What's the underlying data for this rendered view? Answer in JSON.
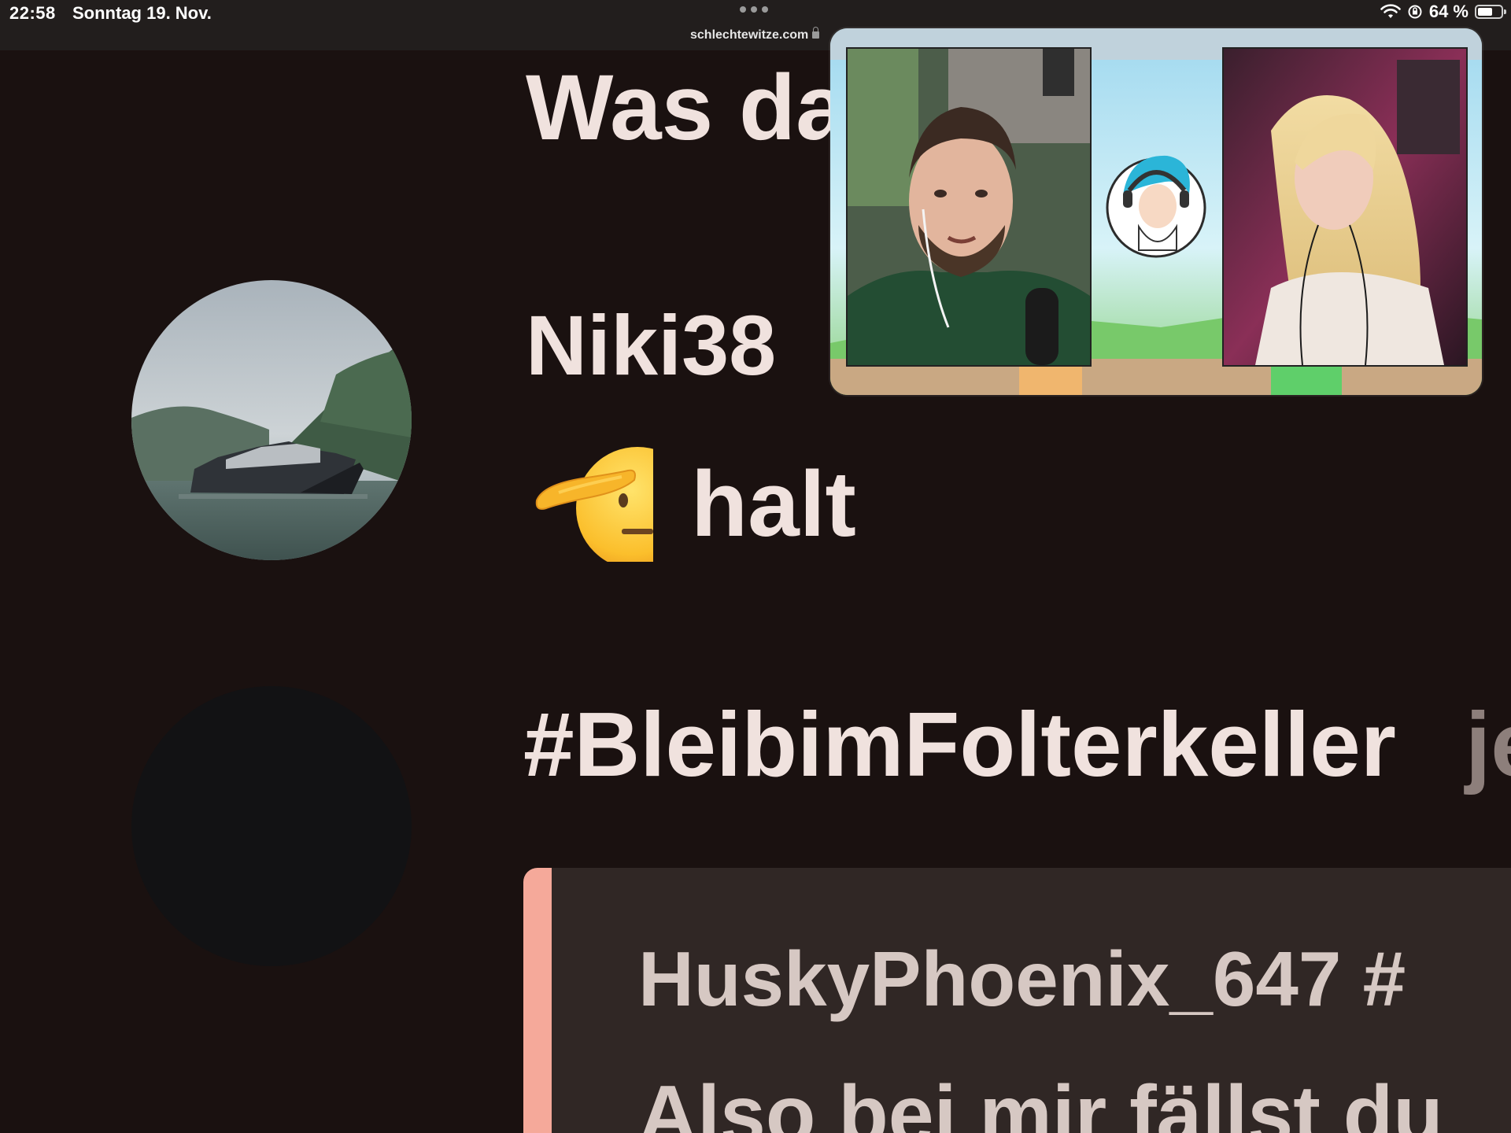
{
  "status_bar": {
    "time": "22:58",
    "date": "Sonntag 19. Nov.",
    "url": "schlechtewitze.com",
    "battery_label": "64 %",
    "battery_level": 0.64,
    "icons": [
      "wifi-icon",
      "orientation-lock-icon",
      "battery-icon",
      "lock-icon"
    ]
  },
  "feed": {
    "line_1": "Was da",
    "line_2": "Niki38",
    "line_3_emoji": "saluting-face-emoji",
    "line_3_text": "halt",
    "hashtag": "#BleibimFolterkeller",
    "hashtag_cut": "je",
    "quote_user": "HuskyPhoenix_647 #",
    "quote_text": "Also bei mir fällst du"
  },
  "pip": {
    "type": "video-overlay",
    "participants": [
      "streamer-man-webcam",
      "streamer-woman-webcam"
    ],
    "center_logo": "cartoon-headphones-girl-logo"
  },
  "colors": {
    "background": "#1a1110",
    "text": "#f0e2de",
    "quote_bar": "#f5a99a",
    "quote_bg": "#302725"
  }
}
